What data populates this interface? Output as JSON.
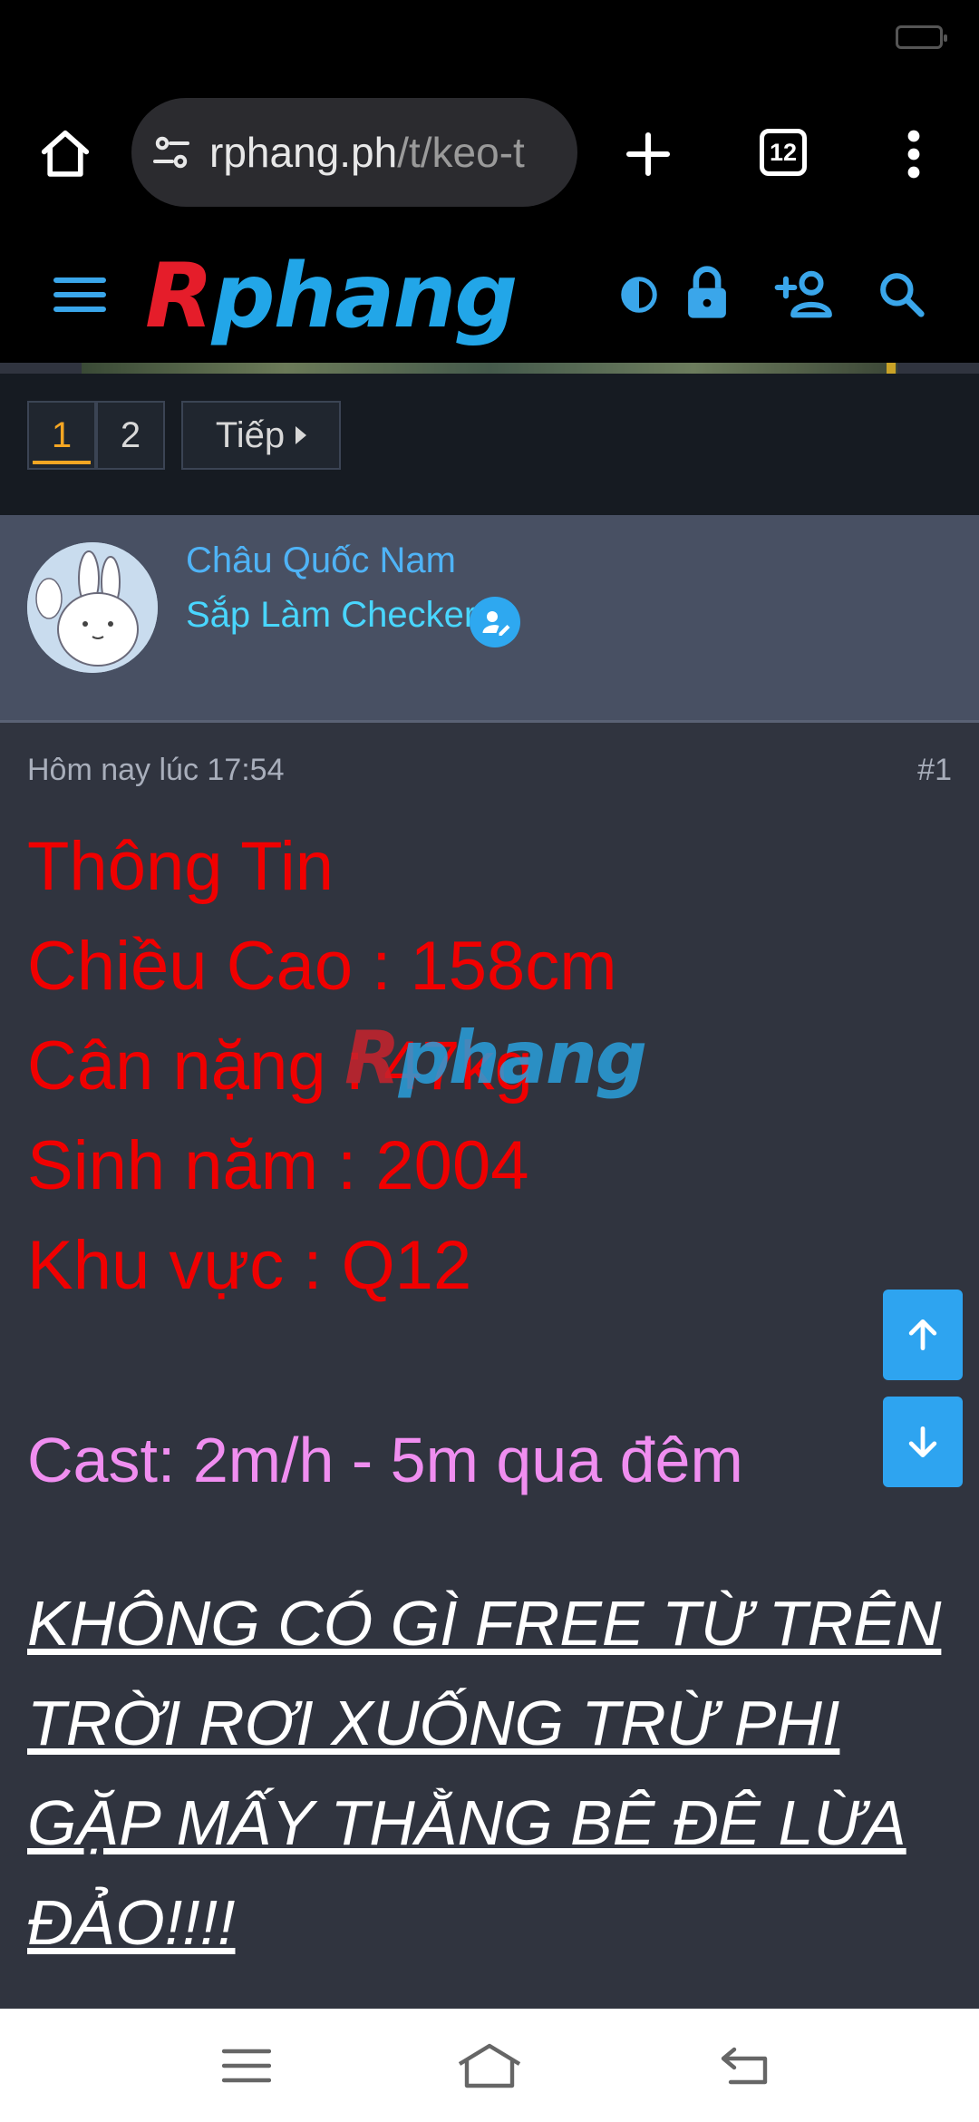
{
  "browser": {
    "url_main": "rphang.ph",
    "url_rest": "/t/keo-t",
    "tab_count": "12"
  },
  "site": {
    "logo_text": "Rphang"
  },
  "pagination": {
    "pages": [
      "1",
      "2"
    ],
    "current": "1",
    "next_label": "Tiếp"
  },
  "author": {
    "name": "Châu Quốc Nam",
    "title": "Sắp Làm Checker"
  },
  "post": {
    "timestamp": "Hôm nay lúc 17:54",
    "number": "#1",
    "info_lines": [
      "Thông Tin",
      "Chiều Cao : 158cm",
      "Cân nặng : 47kg",
      "Sinh năm : 2004",
      "Khu vực : Q12"
    ],
    "cast": "Cast: 2m/h - 5m qua đêm",
    "warning": "KHÔNG CÓ GÌ FREE TỪ TRÊN TRỜI RƠI XUỐNG TRỪ PHI GẶP MẤY THẰNG BÊ ĐÊ LỪA ĐẢO!!!!",
    "watermark": "Rphang"
  },
  "colors": {
    "info_text": "#f00000",
    "cast_text": "#f08ef0",
    "link_blue": "#4fb3f6",
    "accent_orange": "#f5a623"
  },
  "icons": {
    "browser": [
      "home-icon",
      "site-settings-icon",
      "new-tab-icon",
      "tabs-icon",
      "more-vert-icon"
    ],
    "header": [
      "menu-icon",
      "theme-toggle-icon",
      "lock-icon",
      "add-user-icon",
      "search-icon"
    ],
    "scroll": [
      "arrow-up-icon",
      "arrow-down-icon"
    ],
    "system_nav": [
      "recents-icon",
      "home-nav-icon",
      "back-icon"
    ]
  }
}
